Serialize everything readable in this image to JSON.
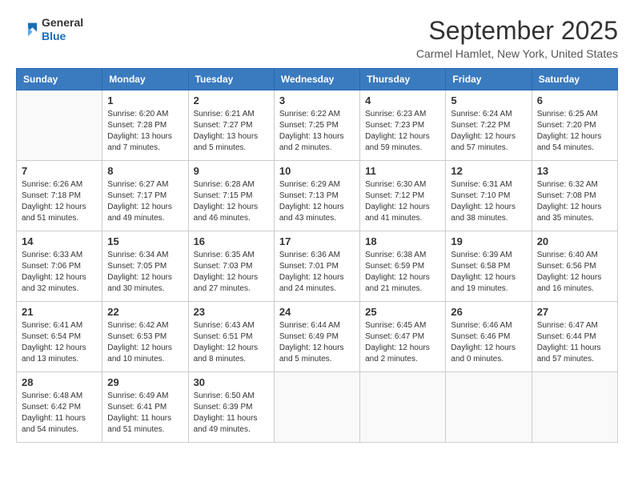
{
  "header": {
    "logo_line1": "General",
    "logo_line2": "Blue",
    "month": "September 2025",
    "location": "Carmel Hamlet, New York, United States"
  },
  "weekdays": [
    "Sunday",
    "Monday",
    "Tuesday",
    "Wednesday",
    "Thursday",
    "Friday",
    "Saturday"
  ],
  "weeks": [
    [
      {
        "day": "",
        "info": ""
      },
      {
        "day": "1",
        "info": "Sunrise: 6:20 AM\nSunset: 7:28 PM\nDaylight: 13 hours\nand 7 minutes."
      },
      {
        "day": "2",
        "info": "Sunrise: 6:21 AM\nSunset: 7:27 PM\nDaylight: 13 hours\nand 5 minutes."
      },
      {
        "day": "3",
        "info": "Sunrise: 6:22 AM\nSunset: 7:25 PM\nDaylight: 13 hours\nand 2 minutes."
      },
      {
        "day": "4",
        "info": "Sunrise: 6:23 AM\nSunset: 7:23 PM\nDaylight: 12 hours\nand 59 minutes."
      },
      {
        "day": "5",
        "info": "Sunrise: 6:24 AM\nSunset: 7:22 PM\nDaylight: 12 hours\nand 57 minutes."
      },
      {
        "day": "6",
        "info": "Sunrise: 6:25 AM\nSunset: 7:20 PM\nDaylight: 12 hours\nand 54 minutes."
      }
    ],
    [
      {
        "day": "7",
        "info": "Sunrise: 6:26 AM\nSunset: 7:18 PM\nDaylight: 12 hours\nand 51 minutes."
      },
      {
        "day": "8",
        "info": "Sunrise: 6:27 AM\nSunset: 7:17 PM\nDaylight: 12 hours\nand 49 minutes."
      },
      {
        "day": "9",
        "info": "Sunrise: 6:28 AM\nSunset: 7:15 PM\nDaylight: 12 hours\nand 46 minutes."
      },
      {
        "day": "10",
        "info": "Sunrise: 6:29 AM\nSunset: 7:13 PM\nDaylight: 12 hours\nand 43 minutes."
      },
      {
        "day": "11",
        "info": "Sunrise: 6:30 AM\nSunset: 7:12 PM\nDaylight: 12 hours\nand 41 minutes."
      },
      {
        "day": "12",
        "info": "Sunrise: 6:31 AM\nSunset: 7:10 PM\nDaylight: 12 hours\nand 38 minutes."
      },
      {
        "day": "13",
        "info": "Sunrise: 6:32 AM\nSunset: 7:08 PM\nDaylight: 12 hours\nand 35 minutes."
      }
    ],
    [
      {
        "day": "14",
        "info": "Sunrise: 6:33 AM\nSunset: 7:06 PM\nDaylight: 12 hours\nand 32 minutes."
      },
      {
        "day": "15",
        "info": "Sunrise: 6:34 AM\nSunset: 7:05 PM\nDaylight: 12 hours\nand 30 minutes."
      },
      {
        "day": "16",
        "info": "Sunrise: 6:35 AM\nSunset: 7:03 PM\nDaylight: 12 hours\nand 27 minutes."
      },
      {
        "day": "17",
        "info": "Sunrise: 6:36 AM\nSunset: 7:01 PM\nDaylight: 12 hours\nand 24 minutes."
      },
      {
        "day": "18",
        "info": "Sunrise: 6:38 AM\nSunset: 6:59 PM\nDaylight: 12 hours\nand 21 minutes."
      },
      {
        "day": "19",
        "info": "Sunrise: 6:39 AM\nSunset: 6:58 PM\nDaylight: 12 hours\nand 19 minutes."
      },
      {
        "day": "20",
        "info": "Sunrise: 6:40 AM\nSunset: 6:56 PM\nDaylight: 12 hours\nand 16 minutes."
      }
    ],
    [
      {
        "day": "21",
        "info": "Sunrise: 6:41 AM\nSunset: 6:54 PM\nDaylight: 12 hours\nand 13 minutes."
      },
      {
        "day": "22",
        "info": "Sunrise: 6:42 AM\nSunset: 6:53 PM\nDaylight: 12 hours\nand 10 minutes."
      },
      {
        "day": "23",
        "info": "Sunrise: 6:43 AM\nSunset: 6:51 PM\nDaylight: 12 hours\nand 8 minutes."
      },
      {
        "day": "24",
        "info": "Sunrise: 6:44 AM\nSunset: 6:49 PM\nDaylight: 12 hours\nand 5 minutes."
      },
      {
        "day": "25",
        "info": "Sunrise: 6:45 AM\nSunset: 6:47 PM\nDaylight: 12 hours\nand 2 minutes."
      },
      {
        "day": "26",
        "info": "Sunrise: 6:46 AM\nSunset: 6:46 PM\nDaylight: 12 hours\nand 0 minutes."
      },
      {
        "day": "27",
        "info": "Sunrise: 6:47 AM\nSunset: 6:44 PM\nDaylight: 11 hours\nand 57 minutes."
      }
    ],
    [
      {
        "day": "28",
        "info": "Sunrise: 6:48 AM\nSunset: 6:42 PM\nDaylight: 11 hours\nand 54 minutes."
      },
      {
        "day": "29",
        "info": "Sunrise: 6:49 AM\nSunset: 6:41 PM\nDaylight: 11 hours\nand 51 minutes."
      },
      {
        "day": "30",
        "info": "Sunrise: 6:50 AM\nSunset: 6:39 PM\nDaylight: 11 hours\nand 49 minutes."
      },
      {
        "day": "",
        "info": ""
      },
      {
        "day": "",
        "info": ""
      },
      {
        "day": "",
        "info": ""
      },
      {
        "day": "",
        "info": ""
      }
    ]
  ]
}
